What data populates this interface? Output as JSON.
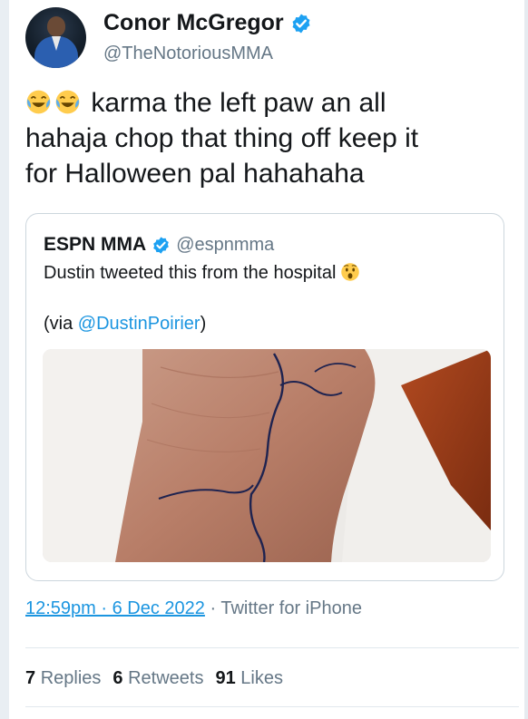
{
  "author": {
    "display_name": "Conor McGregor",
    "handle": "@TheNotoriousMMA",
    "verified_icon": "verified-badge-icon"
  },
  "tweet": {
    "emojis": [
      "face-with-tears-of-joy",
      "face-with-tears-of-joy"
    ],
    "lines": [
      "karma the left paw an all",
      "hahaja chop that thing off keep it",
      "for Halloween pal hahahaha"
    ]
  },
  "quoted_tweet": {
    "display_name": "ESPN MMA",
    "handle": "@espnmma",
    "text": "Dustin tweeted this from the hospital",
    "emoji": "hushed-face",
    "via_prefix": "(via ",
    "via_mention": "@DustinPoirier",
    "via_suffix": ")"
  },
  "meta": {
    "time": "12:59pm · 6 Dec 2022",
    "separator": " · ",
    "source": "Twitter for iPhone"
  },
  "stats": {
    "replies_count": "7",
    "replies_label": "Replies",
    "retweets_count": "6",
    "retweets_label": "Retweets",
    "likes_count": "91",
    "likes_label": "Likes"
  },
  "colors": {
    "link": "#1b95e0",
    "secondary_text": "#657786",
    "primary_text": "#14171a",
    "verified": "#1da1f2"
  }
}
